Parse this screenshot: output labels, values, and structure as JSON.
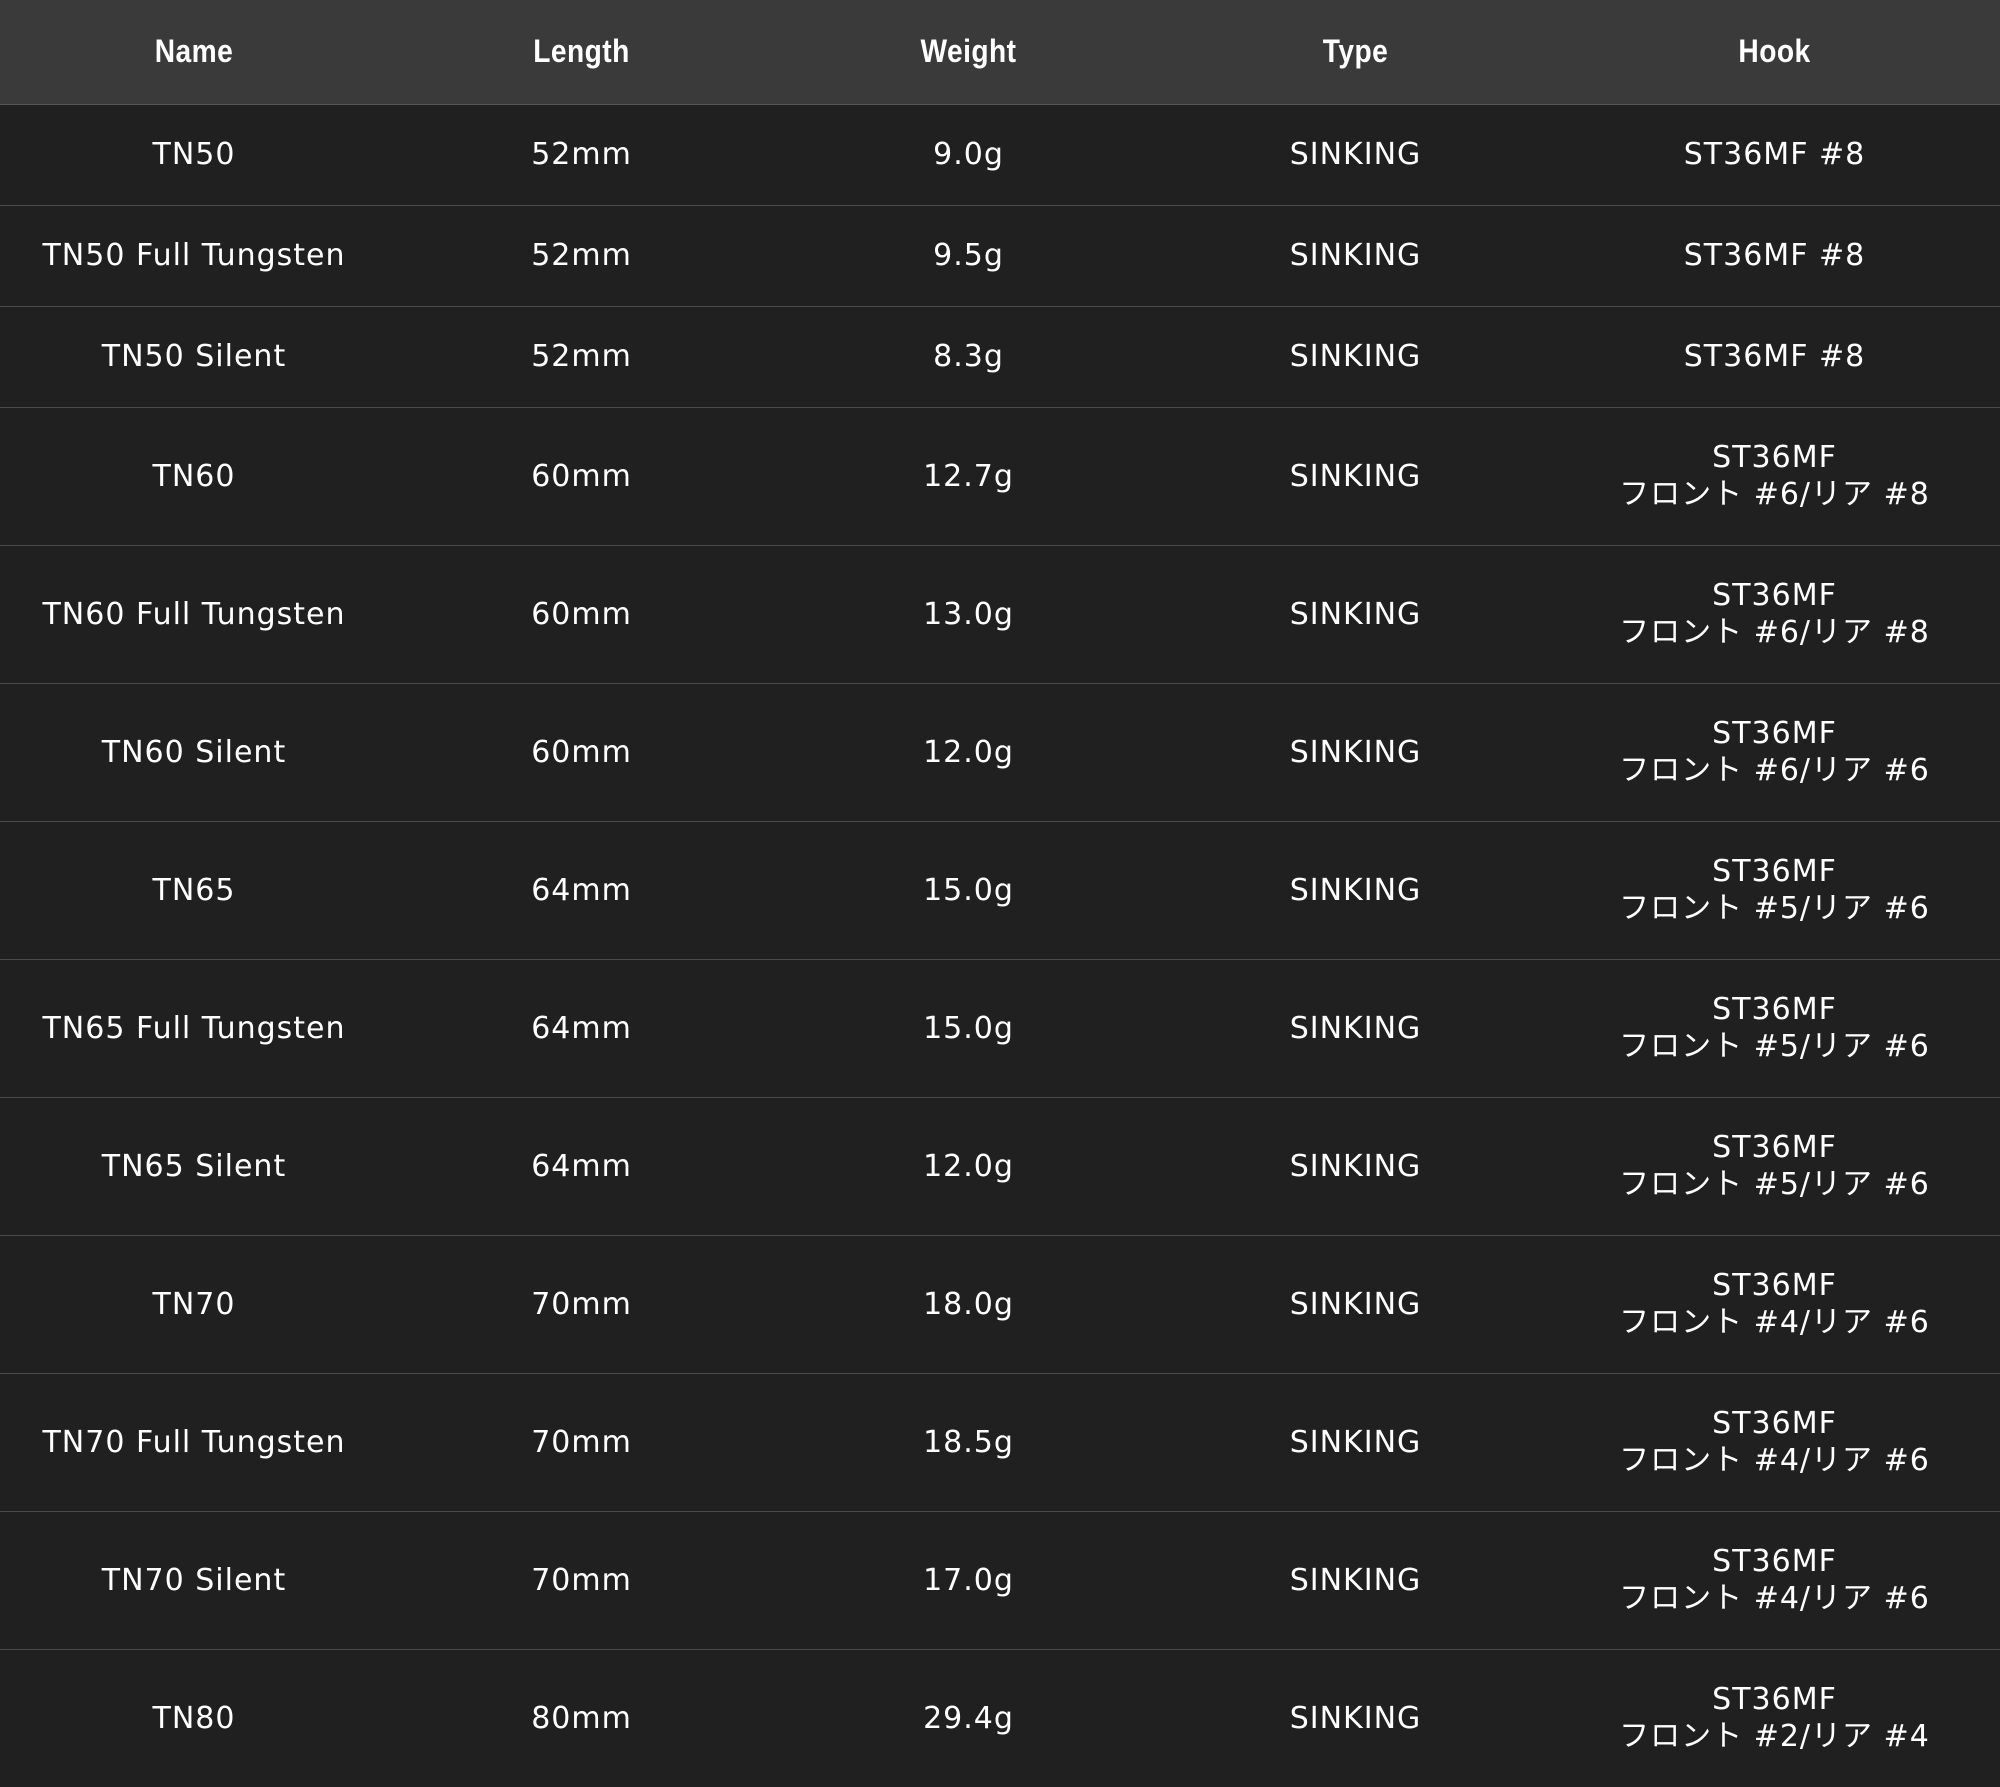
{
  "table": {
    "headers": [
      "Name",
      "Length",
      "Weight",
      "Type",
      "Hook"
    ],
    "rows": [
      {
        "name": "TN50",
        "length": "52mm",
        "weight": "9.0g",
        "type": "SINKING",
        "hook": [
          "ST36MF #8"
        ]
      },
      {
        "name": "TN50 Full Tungsten",
        "length": "52mm",
        "weight": "9.5g",
        "type": "SINKING",
        "hook": [
          "ST36MF #8"
        ]
      },
      {
        "name": "TN50 Silent",
        "length": "52mm",
        "weight": "8.3g",
        "type": "SINKING",
        "hook": [
          "ST36MF #8"
        ]
      },
      {
        "name": "TN60",
        "length": "60mm",
        "weight": "12.7g",
        "type": "SINKING",
        "hook": [
          "ST36MF",
          "フロント #6/リア #8"
        ]
      },
      {
        "name": "TN60 Full Tungsten",
        "length": "60mm",
        "weight": "13.0g",
        "type": "SINKING",
        "hook": [
          "ST36MF",
          "フロント #6/リア #8"
        ]
      },
      {
        "name": "TN60 Silent",
        "length": "60mm",
        "weight": "12.0g",
        "type": "SINKING",
        "hook": [
          "ST36MF",
          "フロント #6/リア #6"
        ]
      },
      {
        "name": "TN65",
        "length": "64mm",
        "weight": "15.0g",
        "type": "SINKING",
        "hook": [
          "ST36MF",
          "フロント #5/リア #6"
        ]
      },
      {
        "name": "TN65 Full Tungsten",
        "length": "64mm",
        "weight": "15.0g",
        "type": "SINKING",
        "hook": [
          "ST36MF",
          "フロント #5/リア #6"
        ]
      },
      {
        "name": "TN65 Silent",
        "length": "64mm",
        "weight": "12.0g",
        "type": "SINKING",
        "hook": [
          "ST36MF",
          "フロント #5/リア #6"
        ]
      },
      {
        "name": "TN70",
        "length": "70mm",
        "weight": "18.0g",
        "type": "SINKING",
        "hook": [
          "ST36MF",
          "フロント #4/リア #6"
        ]
      },
      {
        "name": "TN70 Full Tungsten",
        "length": "70mm",
        "weight": "18.5g",
        "type": "SINKING",
        "hook": [
          "ST36MF",
          "フロント #4/リア #6"
        ]
      },
      {
        "name": "TN70 Silent",
        "length": "70mm",
        "weight": "17.0g",
        "type": "SINKING",
        "hook": [
          "ST36MF",
          "フロント #4/リア #6"
        ]
      },
      {
        "name": "TN80",
        "length": "80mm",
        "weight": "29.4g",
        "type": "SINKING",
        "hook": [
          "ST36MF",
          "フロント #2/リア #4"
        ]
      }
    ]
  }
}
